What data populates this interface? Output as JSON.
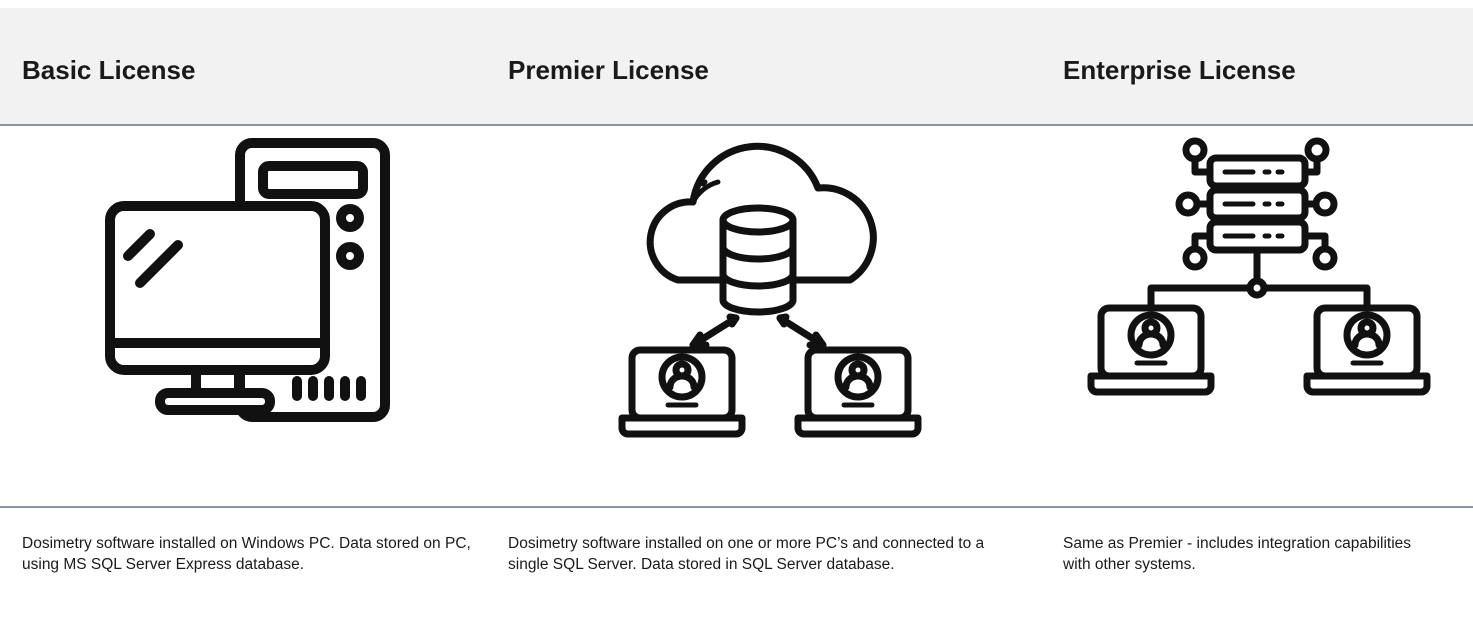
{
  "columns": [
    {
      "title": "Basic License",
      "icon": "desktop-computer-icon",
      "description": "Dosimetry software installed on Windows PC.  Data stored on PC, using MS SQL Server Express database."
    },
    {
      "title": "Premier License",
      "icon": "cloud-database-network-icon",
      "description": "Dosimetry software installed on one or more PC’s and connected to a single SQL Server.  Data stored in SQL Server database."
    },
    {
      "title": "Enterprise License",
      "icon": "server-network-integration-icon",
      "description": "Same as Premier - includes integration capabilities with other systems."
    }
  ],
  "colors": {
    "header_bg": "#f2f2f2",
    "rule": "#8e95a0",
    "text": "#1a1a1a"
  }
}
